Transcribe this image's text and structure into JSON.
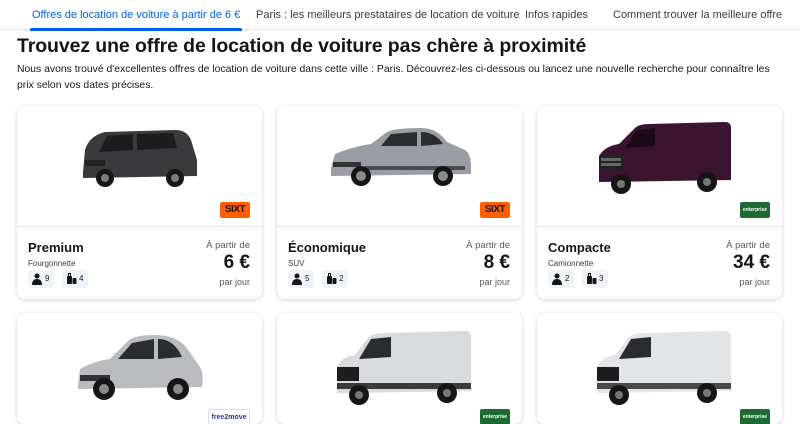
{
  "tabs": [
    {
      "label": "Offres de location de voiture à partir de 6 €"
    },
    {
      "label": "Paris : les meilleurs prestataires de location de voiture"
    },
    {
      "label": "Infos rapides"
    },
    {
      "label": "Comment trouver la meilleure offre"
    }
  ],
  "heading": "Trouvez une offre de location de voiture pas chère à proximité",
  "intro": "Nous avons trouvé d'excellentes offres de location de voiture dans cette ville : Paris. Découvrez-les ci-dessous ou lancez une nouvelle recherche pour connaître les prix selon vos dates précises.",
  "cards": [
    {
      "category": "Premium",
      "subtitle": "Fourgonnette",
      "from_label": "À partir de",
      "price": "6 €",
      "per_day": "par jour",
      "seats": "9",
      "bags": "4",
      "provider": "SIXT",
      "car_color": "#3a3a3c",
      "car_icon": "van-car-icon"
    },
    {
      "category": "Économique",
      "subtitle": "SUV",
      "from_label": "À partir de",
      "price": "8 €",
      "per_day": "par jour",
      "seats": "5",
      "bags": "2",
      "provider": "SIXT",
      "car_color": "#9a9da3",
      "car_icon": "suv-car-icon"
    },
    {
      "category": "Compacte",
      "subtitle": "Camionnette",
      "from_label": "À partir de",
      "price": "34 €",
      "per_day": "par jour",
      "seats": "2",
      "bags": "3",
      "provider": "enterprise",
      "car_color": "#3b1430",
      "car_icon": "cargo-van-icon"
    },
    {
      "provider": "free2move",
      "car_color": "#b9bbbe",
      "car_icon": "hatchback-car-icon"
    },
    {
      "provider": "enterprise",
      "car_color": "#d9dadc",
      "car_icon": "cargo-van-icon"
    },
    {
      "provider": "enterprise",
      "car_color": "#e3e4e6",
      "car_icon": "cargo-van-icon"
    }
  ],
  "colors": {
    "accent": "#0062e3",
    "sixt": "#ff5f00",
    "enterprise": "#1c6b33",
    "badge_bg": "#eff3f8"
  }
}
